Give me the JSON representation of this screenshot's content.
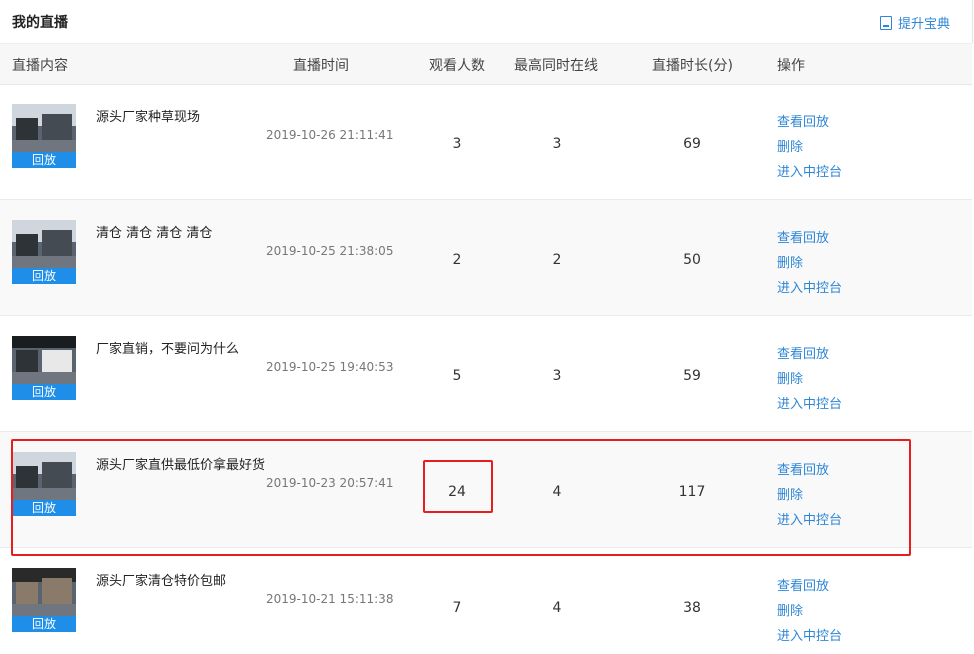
{
  "page": {
    "title": "我的直播",
    "tip_label": "提升宝典"
  },
  "columns": {
    "content": "直播内容",
    "time": "直播时间",
    "viewers": "观看人数",
    "peak": "最高同时在线",
    "duration": "直播时长(分)",
    "actions": "操作"
  },
  "rows": [
    {
      "title": "源头厂家种草现场",
      "time": "2019-10-26 21:11:41",
      "viewers": "3",
      "peak": "3",
      "duration": "69",
      "replay": "回放"
    },
    {
      "title": "清仓 清仓 清仓 清仓",
      "time": "2019-10-25 21:38:05",
      "viewers": "2",
      "peak": "2",
      "duration": "50",
      "replay": "回放"
    },
    {
      "title": "厂家直销，不要问为什么",
      "time": "2019-10-25 19:40:53",
      "viewers": "5",
      "peak": "3",
      "duration": "59",
      "replay": "回放"
    },
    {
      "title": "源头厂家直供最低价拿最好货",
      "time": "2019-10-23 20:57:41",
      "viewers": "24",
      "peak": "4",
      "duration": "117",
      "replay": "回放"
    },
    {
      "title": "源头厂家清仓特价包邮",
      "time": "2019-10-21 15:11:38",
      "viewers": "7",
      "peak": "4",
      "duration": "38",
      "replay": "回放"
    }
  ],
  "actions": {
    "view_replay": "查看回放",
    "delete": "删除",
    "console": "进入中控台"
  },
  "colors": {
    "link": "#2e86d6",
    "replay_badge": "#1e8ee8",
    "highlight": "#e81d1d"
  }
}
